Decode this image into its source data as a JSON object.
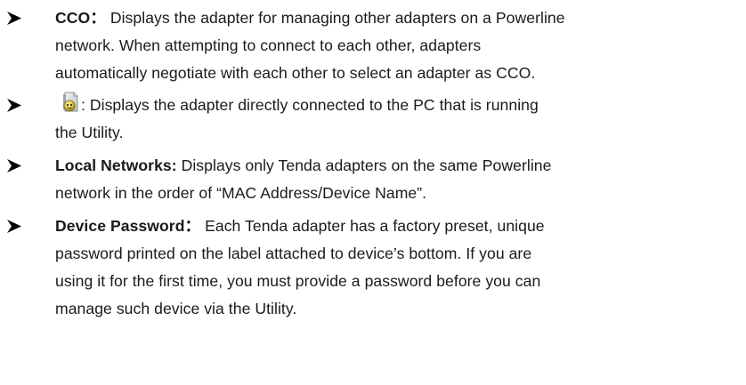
{
  "items": [
    {
      "term": "CCO",
      "separator": "：",
      "lines": [
        " Displays the adapter for managing other adapters on a Powerline",
        "network. When attempting to connect to each other, adapters",
        "automatically negotiate with each other to select an adapter as CCO."
      ]
    },
    {
      "icon": "local-adapter-icon",
      "lines": [
        ": Displays the adapter directly connected to the PC that is running",
        "the Utility."
      ]
    },
    {
      "term": "Local Networks:",
      "lines": [
        " Displays only Tenda adapters on the same Powerline",
        "network in the order of “MAC Address/Device Name”."
      ]
    },
    {
      "term": "Device Password",
      "separator": "：",
      "lines": [
        " Each Tenda adapter has a factory preset, unique",
        "password printed on the label attached to device’s bottom. If you are",
        "using it for the first time, you must provide a password before you can",
        "manage such device via the Utility."
      ]
    }
  ],
  "colors": {
    "text": "#1a1a1a",
    "bullet": "#000000"
  }
}
